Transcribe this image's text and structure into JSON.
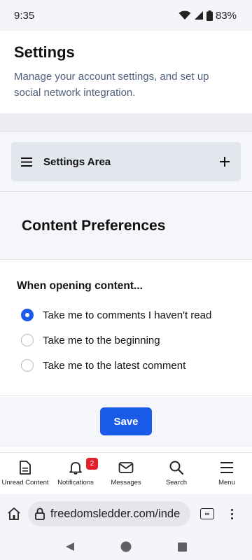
{
  "status_bar": {
    "time": "9:35",
    "battery": "83%",
    "icons": [
      "wifi-icon",
      "signal-icon",
      "battery-icon"
    ]
  },
  "header": {
    "title": "Settings",
    "subtitle": "Manage your account settings, and set up social network integration."
  },
  "settings_area": {
    "label": "Settings Area",
    "icons": [
      "menu-icon",
      "plus-icon"
    ]
  },
  "content_preferences": {
    "title": "Content Preferences",
    "question": "When opening content...",
    "options": [
      {
        "label": "Take me to comments I haven't read",
        "checked": true
      },
      {
        "label": "Take me to the beginning",
        "checked": false
      },
      {
        "label": "Take me to the latest comment",
        "checked": false
      }
    ],
    "save_label": "Save"
  },
  "bottom_nav": {
    "items": [
      {
        "label": "Unread Content",
        "icon": "document-icon"
      },
      {
        "label": "Notifications",
        "icon": "bell-icon",
        "badge": "2"
      },
      {
        "label": "Messages",
        "icon": "envelope-icon"
      },
      {
        "label": "Search",
        "icon": "search-icon"
      },
      {
        "label": "Menu",
        "icon": "menu-icon"
      }
    ]
  },
  "browser": {
    "url": "freedomsledder.com/inde",
    "icons": [
      "home-icon",
      "lock-icon",
      "tab-switcher-icon",
      "more-icon"
    ]
  },
  "system_nav": {
    "icons": [
      "back-icon",
      "home-circle-icon",
      "recents-icon"
    ]
  },
  "colors": {
    "accent": "#1a5ae8",
    "subtitle": "#4e5f7e",
    "badge": "#e0202a",
    "section_bg": "#f5f6f9",
    "settings_bar_bg": "#e3e6ec"
  }
}
